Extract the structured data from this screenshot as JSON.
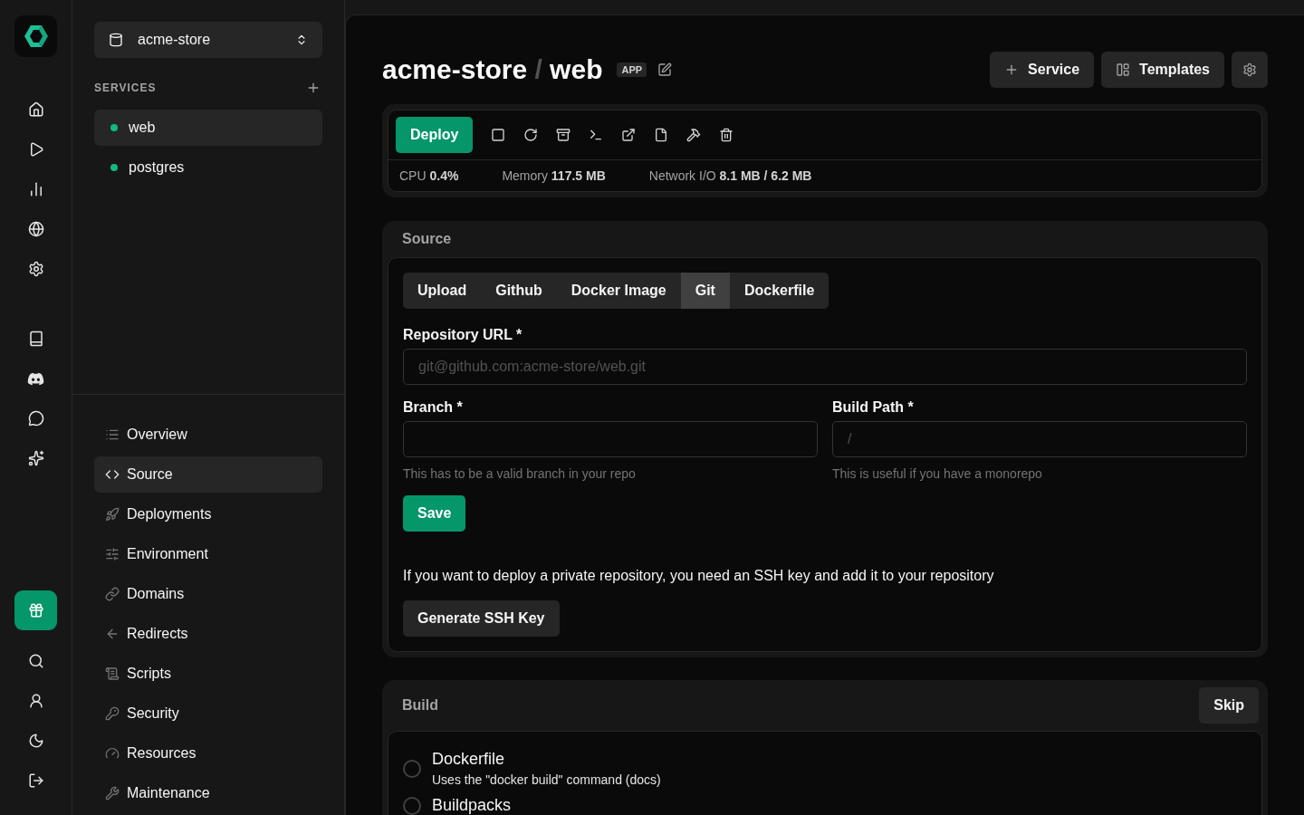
{
  "project_switcher": {
    "name": "acme-store"
  },
  "services": {
    "heading": "SERVICES",
    "items": [
      {
        "name": "web",
        "color": "#10b981",
        "selected": true
      },
      {
        "name": "postgres",
        "color": "#10b981",
        "selected": false
      }
    ]
  },
  "nav": [
    {
      "label": "Overview",
      "selected": false
    },
    {
      "label": "Source",
      "selected": true
    },
    {
      "label": "Deployments",
      "selected": false
    },
    {
      "label": "Environment",
      "selected": false
    },
    {
      "label": "Domains",
      "selected": false
    },
    {
      "label": "Redirects",
      "selected": false
    },
    {
      "label": "Scripts",
      "selected": false
    },
    {
      "label": "Security",
      "selected": false
    },
    {
      "label": "Resources",
      "selected": false
    },
    {
      "label": "Maintenance",
      "selected": false
    }
  ],
  "header": {
    "project": "acme-store",
    "separator": "/",
    "service": "web",
    "badge": "APP",
    "buttons": [
      "Service",
      "Templates"
    ]
  },
  "toolbar": {
    "deploy": "Deploy",
    "stats": [
      {
        "label": "CPU",
        "value": "0.4%"
      },
      {
        "label": "Memory",
        "value": "117.5 MB"
      },
      {
        "label": "Network I/O",
        "value": "8.1 MB / 6.2 MB"
      }
    ]
  },
  "source": {
    "title": "Source",
    "tabs": [
      {
        "label": "Upload",
        "selected": false
      },
      {
        "label": "Github",
        "selected": false
      },
      {
        "label": "Docker Image",
        "selected": false
      },
      {
        "label": "Git",
        "selected": true
      },
      {
        "label": "Dockerfile",
        "selected": false
      }
    ],
    "repository": {
      "label": "Repository URL *",
      "placeholder": "git@github.com:acme-store/web.git"
    },
    "branch": {
      "label": "Branch *",
      "hint": "This has to be a valid branch in your repo"
    },
    "build_path": {
      "label": "Build Path *",
      "placeholder": "/",
      "hint": "This is useful if you have a monorepo"
    },
    "save": "Save",
    "info": "If you want to deploy a private repository, you need an SSH key and add it to your repository",
    "ssh_button": "Generate SSH Key"
  },
  "build": {
    "title": "Build",
    "skip": "Skip",
    "options": [
      {
        "title": "Dockerfile",
        "description": "Uses the \"docker build\" command (",
        "link": "docs",
        "suffix": ")",
        "selected": false
      },
      {
        "title": "Buildpacks",
        "selected": false
      }
    ]
  }
}
